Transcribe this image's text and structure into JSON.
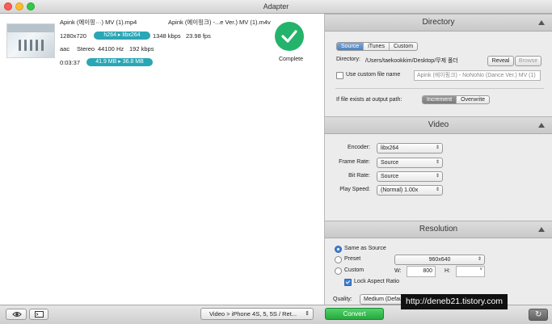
{
  "window": {
    "title": "Adapter"
  },
  "queue_item": {
    "input_name": "Apink (에이핑···) MV (1).mp4",
    "output_name": "Apink (에이핑크) -...e Ver.) MV (1).m4v",
    "resolution": "1280x720",
    "video_codec": "h264 ▸ libx264",
    "video_bitrate": "1348 kbps",
    "fps": "23.98 fps",
    "audio_codec": "aac",
    "audio_channels": "Stereo",
    "audio_rate": "44100 Hz",
    "audio_bitrate": "192 kbps",
    "duration": "0:03:37",
    "size": "41.9 MB ▸ 36.8 MB",
    "status": "Complete"
  },
  "directory": {
    "title": "Directory",
    "tabs": [
      "Source",
      "iTunes",
      "Custom"
    ],
    "selected_tab": "Source",
    "directory_label": "Directory:",
    "directory_value": "/Users/taekookkim/Desktop/무제 폴더",
    "reveal": "Reveal",
    "browse": "Browse",
    "custom_name_label": "Use custom file name",
    "custom_name_placeholder": "Apink (에이핑크) - NoNoNo (Dance Ver.) MV (1)",
    "exists_label": "If file exists at output path:",
    "exists_options": [
      "Increment",
      "Overwrite"
    ],
    "exists_selected": "Increment"
  },
  "video": {
    "title": "Video",
    "encoder_label": "Encoder:",
    "encoder": "libx264",
    "frame_rate_label": "Frame Rate:",
    "frame_rate": "Source",
    "bit_rate_label": "Bit Rate:",
    "bit_rate": "Source",
    "play_speed_label": "Play Speed:",
    "play_speed": "(Normal) 1.00x"
  },
  "resolution": {
    "title": "Resolution",
    "same_as_source": "Same as Source",
    "preset": "Preset",
    "preset_value": "960x640",
    "custom": "Custom",
    "w_label": "W:",
    "w_value": "800",
    "h_label": "H:",
    "h_value": "",
    "lock_aspect": "Lock Aspect Ratio",
    "quality_label": "Quality:",
    "quality_value": "Medium (Defau..."
  },
  "bottom": {
    "preset_select": "Video > iPhone 4S, 5, 5S / Ret...",
    "convert": "Convert"
  },
  "watermark": "http://deneb21.tistory.com",
  "colors": {
    "accent": "#2aa6b5",
    "complete": "#24b36b",
    "convert": "#2fbf4a"
  }
}
